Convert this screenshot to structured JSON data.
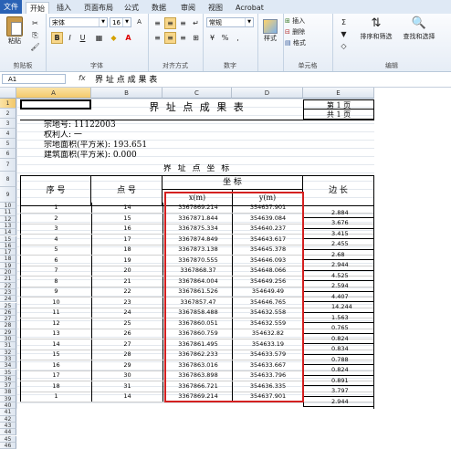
{
  "ribbon": {
    "tabs": [
      "文件",
      "开始",
      "插入",
      "页面布局",
      "公式",
      "数据",
      "审阅",
      "视图",
      "Acrobat"
    ],
    "font_name": "宋体",
    "font_size": "16",
    "number_format": "常规",
    "buttons": {
      "paste": "粘贴",
      "style": "样式",
      "insert": "插入",
      "delete": "删除",
      "format": "格式",
      "sort": "排序和筛选",
      "find": "查找和选择"
    },
    "groups": [
      "剪贴板",
      "字体",
      "对齐方式",
      "数字",
      "单元格",
      "编辑"
    ]
  },
  "formula_bar": {
    "name_box": "A1",
    "fx": "fx",
    "value": "界 址 点 成 果 表"
  },
  "columns": [
    "A",
    "B",
    "C",
    "D",
    "E"
  ],
  "rows": [
    "1",
    "2",
    "3",
    "4",
    "5",
    "6",
    "7",
    "8",
    "9",
    "10",
    "11",
    "12",
    "13",
    "14",
    "15",
    "16",
    "17",
    "18",
    "19",
    "20",
    "21",
    "22",
    "23",
    "24",
    "25",
    "26",
    "27",
    "28",
    "29",
    "30",
    "31",
    "32",
    "33",
    "34",
    "35",
    "36",
    "37",
    "38",
    "39",
    "40",
    "41",
    "42",
    "43",
    "44",
    "45",
    "46"
  ],
  "sheet": {
    "title": "界 址 点 成 果 表",
    "page_num": "第 1 页",
    "page_total": "共 1 页",
    "parcel_no": "宗地号: 11122003",
    "owner": "权利人: 一",
    "area": "宗地面积(平方米): 193.651",
    "building_area": "建筑面积(平方米): 0.000",
    "section_title": "界 址 点 坐 标",
    "col_seq": "序 号",
    "col_point": "点 号",
    "col_coord": "坐 标",
    "col_x": "x(m)",
    "col_y": "y(m)",
    "col_edge": "边 长",
    "data_rows": [
      {
        "seq": "1",
        "pt": "14",
        "x": "3367869.214",
        "y": "354637.901"
      },
      {
        "seq": "2",
        "pt": "15",
        "x": "3367871.844",
        "y": "354639.084"
      },
      {
        "seq": "3",
        "pt": "16",
        "x": "3367875.334",
        "y": "354640.237"
      },
      {
        "seq": "4",
        "pt": "17",
        "x": "3367874.849",
        "y": "354643.617"
      },
      {
        "seq": "5",
        "pt": "18",
        "x": "3367873.138",
        "y": "354645.378"
      },
      {
        "seq": "6",
        "pt": "19",
        "x": "3367870.555",
        "y": "354646.093"
      },
      {
        "seq": "7",
        "pt": "20",
        "x": "3367868.37",
        "y": "354648.066"
      },
      {
        "seq": "8",
        "pt": "21",
        "x": "3367864.004",
        "y": "354649.256"
      },
      {
        "seq": "9",
        "pt": "22",
        "x": "3367861.526",
        "y": "354649.49"
      },
      {
        "seq": "10",
        "pt": "23",
        "x": "3367857.47",
        "y": "354646.765"
      },
      {
        "seq": "11",
        "pt": "24",
        "x": "3367858.488",
        "y": "354632.558"
      },
      {
        "seq": "12",
        "pt": "25",
        "x": "3367860.051",
        "y": "354632.559"
      },
      {
        "seq": "13",
        "pt": "26",
        "x": "3367860.759",
        "y": "354632.82"
      },
      {
        "seq": "14",
        "pt": "27",
        "x": "3367861.495",
        "y": "354633.19"
      },
      {
        "seq": "15",
        "pt": "28",
        "x": "3367862.233",
        "y": "354633.579"
      },
      {
        "seq": "16",
        "pt": "29",
        "x": "3367863.016",
        "y": "354633.667"
      },
      {
        "seq": "17",
        "pt": "30",
        "x": "3367863.898",
        "y": "354633.796"
      },
      {
        "seq": "18",
        "pt": "31",
        "x": "3367866.721",
        "y": "354636.335"
      },
      {
        "seq": "1",
        "pt": "14",
        "x": "3367869.214",
        "y": "354637.901"
      }
    ],
    "edges": [
      "2.884",
      "3.676",
      "3.415",
      "2.455",
      "2.68",
      "2.944",
      "4.525",
      "2.594",
      "4.407",
      "14.244",
      "1.563",
      "0.765",
      "0.824",
      "0.834",
      "0.788",
      "0.824",
      "0.891",
      "3.797",
      "2.944"
    ]
  }
}
